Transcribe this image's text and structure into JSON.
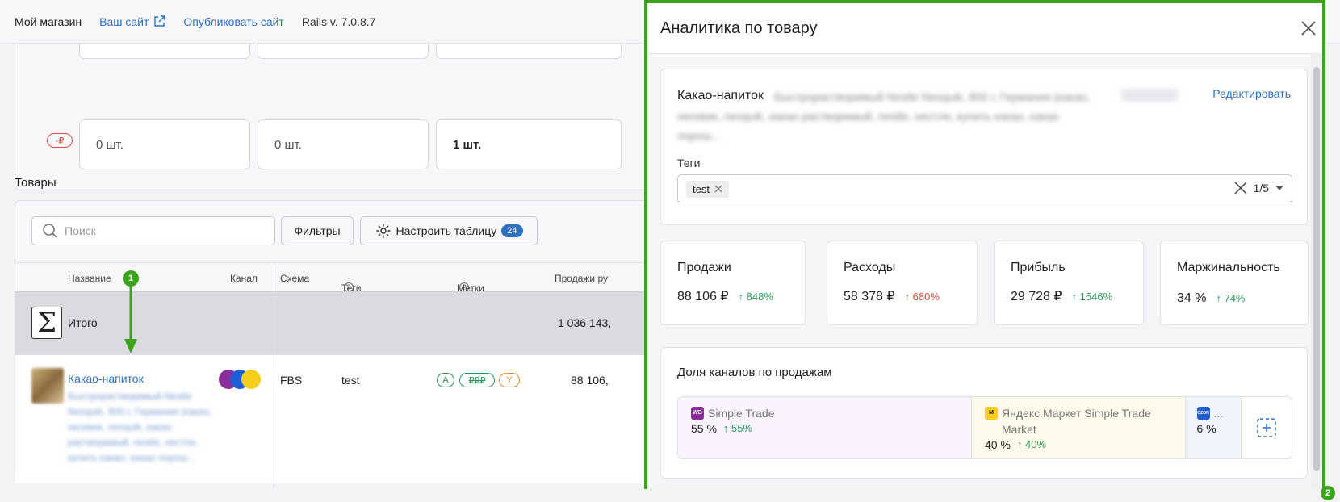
{
  "topbar": {
    "brand": "Мой магазин",
    "your_site": "Ваш сайт",
    "publish": "Опубликовать сайт",
    "version": "Rails v. 7.0.8.7"
  },
  "stock_row": {
    "currency_badge": "-₽",
    "values": [
      "0 шт.",
      "0 шт.",
      "1 шт."
    ]
  },
  "products": {
    "title": "Товары",
    "search_placeholder": "Поиск",
    "filters_label": "Фильтры",
    "configure_label": "Настроить таблицу",
    "configure_count": "24",
    "columns": [
      "Название",
      "Канал",
      "Схема",
      "Теги",
      "Метки",
      "Продажи ру"
    ],
    "total": {
      "label": "Итого",
      "sales": "1 036 143,"
    },
    "row": {
      "name": "Какао-напиток",
      "description": "Быстрорастворимый Nestle Nesquik, 800 г, Германия (какао, несквик, nesquik, какао растворимый, nestle, нестле, купить какао, какао порош...",
      "scheme": "FBS",
      "tag": "test",
      "labels": [
        "A",
        "₽₽₽",
        "Y"
      ],
      "sales": "88 106,"
    }
  },
  "markers": {
    "first": "1",
    "second": "2"
  },
  "drawer": {
    "title": "Аналитика по товару",
    "product_name": "Какао-напиток",
    "product_desc": "Быстрорастворимый Nestle Nesquik, 800 г, Германия (какао, несквик, nesquik, какао растворимый, nestle, нестле, купить какао, какао порош...",
    "edit_label": "Редактировать",
    "tags_label": "Теги",
    "tag_value": "test",
    "tags_count": "1/5",
    "metrics": [
      {
        "title": "Продажи",
        "value": "88 106 ₽",
        "change": "↑ 848%",
        "trend": "up-good"
      },
      {
        "title": "Расходы",
        "value": "58 378 ₽",
        "change": "↑ 680%",
        "trend": "up-bad"
      },
      {
        "title": "Прибыль",
        "value": "29 728 ₽",
        "change": "↑ 1546%",
        "trend": "up-good"
      },
      {
        "title": "Маржинальность",
        "value": "34 %",
        "change": "↑ 74%",
        "trend": "up-good"
      }
    ],
    "share": {
      "title": "Доля каналов по продажам",
      "channels": [
        {
          "name": "Simple Trade",
          "percent": "55 %",
          "change": "↑ 55%",
          "logo": "WB",
          "bg": "#f8f3fc"
        },
        {
          "name": "Яндекс.Маркет Simple Trade Market",
          "percent": "40 %",
          "change": "↑ 40%",
          "logo": "YM",
          "bg": "#fffaea"
        },
        {
          "name": "...",
          "percent": "6 %",
          "change": "",
          "logo": "OZON",
          "bg": "#f0f5fc"
        }
      ]
    }
  },
  "colors": {
    "accent": "#2f6fbf",
    "highlight": "#3aa41a",
    "positive": "#2a9b5c",
    "negative": "#e04b3f"
  }
}
